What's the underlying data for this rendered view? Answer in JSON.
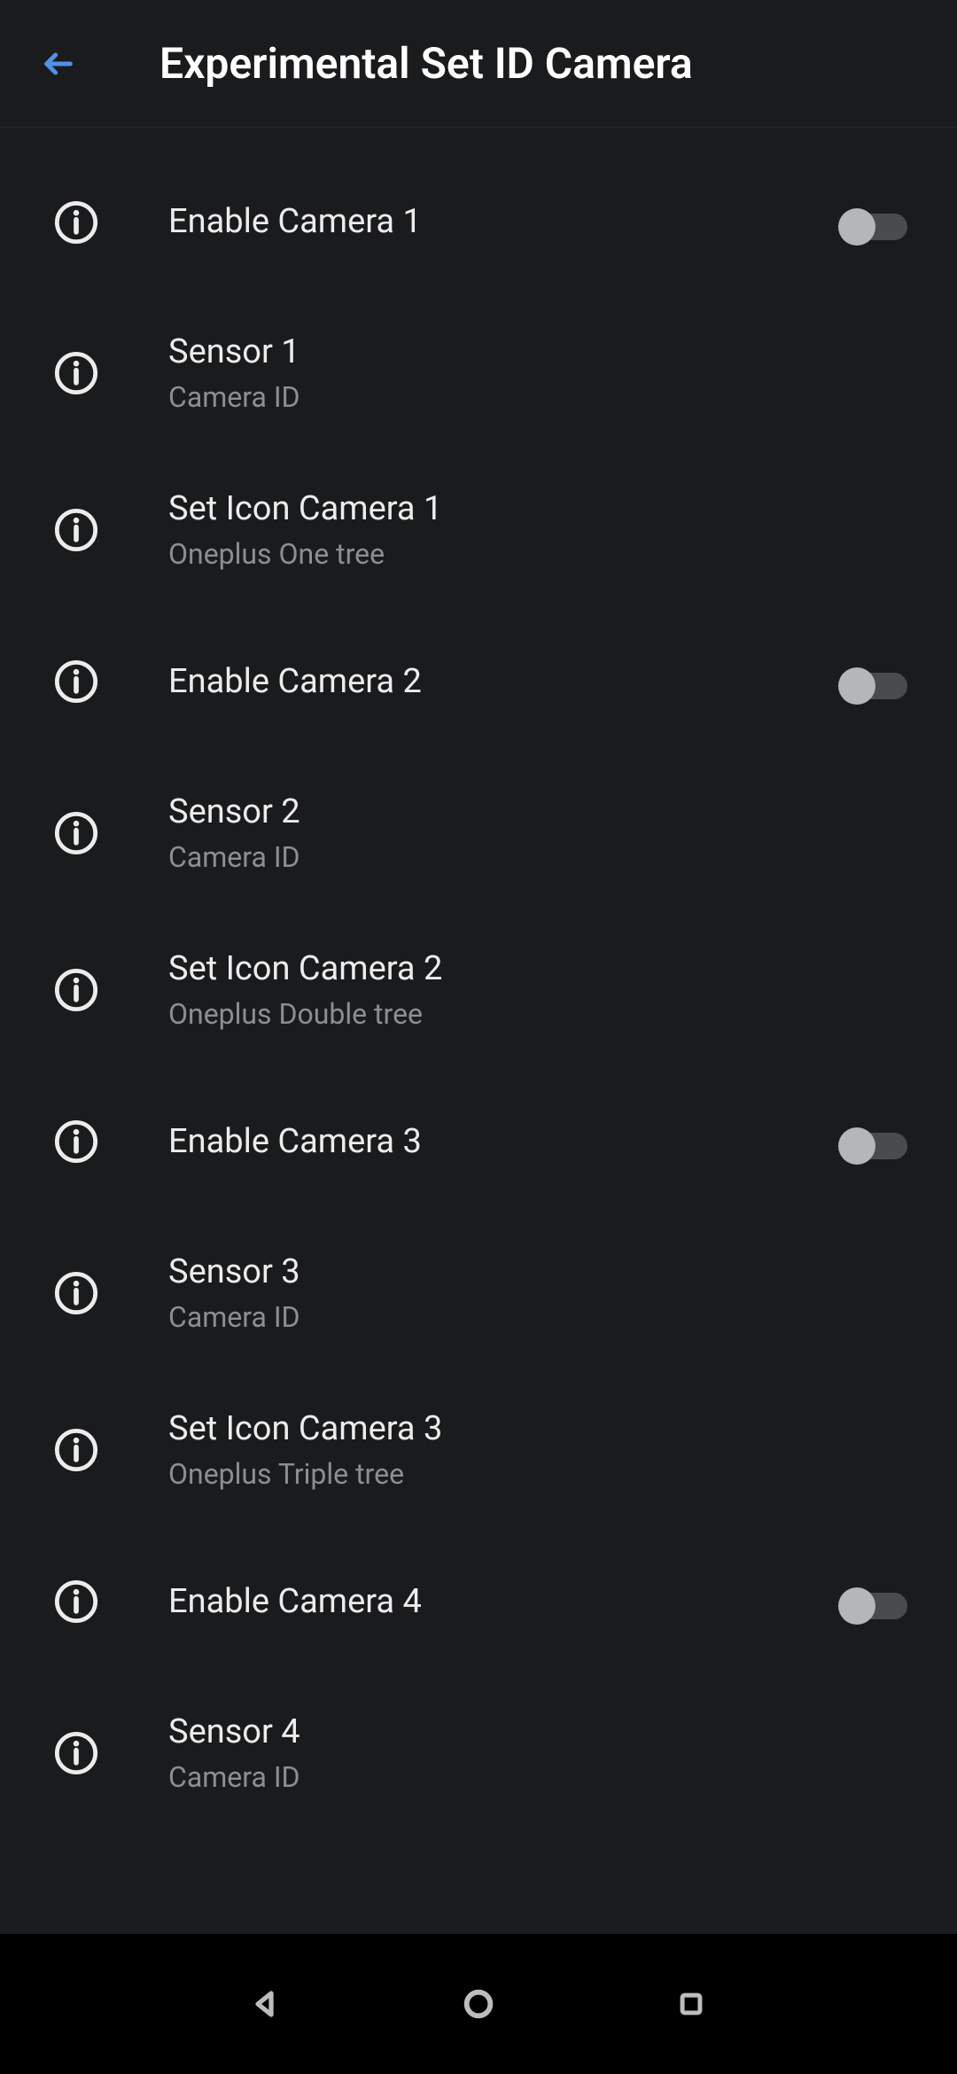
{
  "header": {
    "title": "Experimental Set ID Camera"
  },
  "items": [
    {
      "name": "enable-camera-1",
      "title": "Enable Camera 1",
      "sub": "",
      "toggle": true,
      "on": false
    },
    {
      "name": "sensor-1",
      "title": "Sensor 1",
      "sub": "Camera ID",
      "toggle": false
    },
    {
      "name": "set-icon-camera-1",
      "title": "Set Icon Camera 1",
      "sub": "Oneplus One tree",
      "toggle": false
    },
    {
      "name": "enable-camera-2",
      "title": "Enable Camera 2",
      "sub": "",
      "toggle": true,
      "on": false
    },
    {
      "name": "sensor-2",
      "title": "Sensor 2",
      "sub": "Camera ID",
      "toggle": false
    },
    {
      "name": "set-icon-camera-2",
      "title": "Set Icon Camera 2",
      "sub": "Oneplus Double tree",
      "toggle": false
    },
    {
      "name": "enable-camera-3",
      "title": "Enable Camera 3",
      "sub": "",
      "toggle": true,
      "on": false
    },
    {
      "name": "sensor-3",
      "title": "Sensor 3",
      "sub": "Camera ID",
      "toggle": false
    },
    {
      "name": "set-icon-camera-3",
      "title": "Set Icon Camera 3",
      "sub": "Oneplus Triple tree",
      "toggle": false
    },
    {
      "name": "enable-camera-4",
      "title": "Enable Camera 4",
      "sub": "",
      "toggle": true,
      "on": false
    },
    {
      "name": "sensor-4",
      "title": "Sensor 4",
      "sub": "Camera ID",
      "toggle": false
    }
  ]
}
